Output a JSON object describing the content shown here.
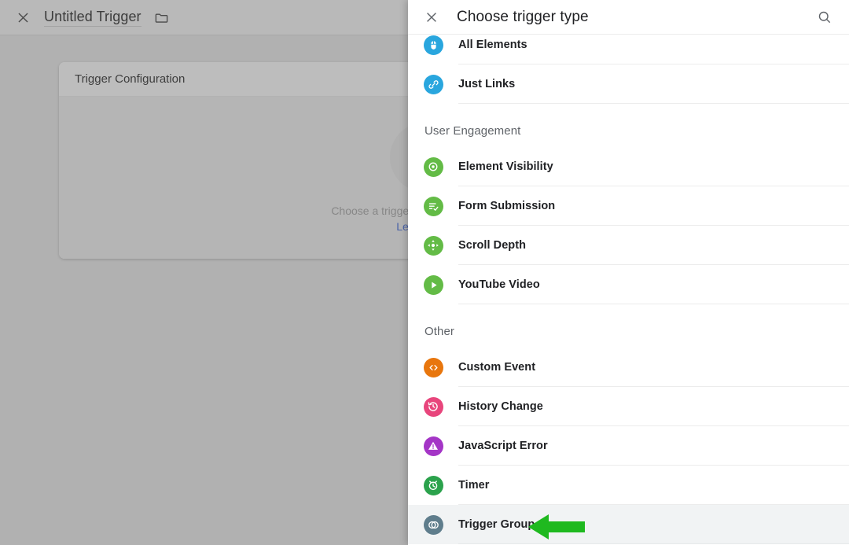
{
  "background": {
    "close_icon": "close-icon",
    "trigger_name": "Untitled Trigger",
    "folder_icon": "folder-icon",
    "card": {
      "title": "Trigger Configuration",
      "placeholder_icon": "trigger-group-icon",
      "hint": "Choose a trigger type to begin setup...",
      "link": "Learn More"
    }
  },
  "panel": {
    "close_icon": "close-icon",
    "title": "Choose trigger type",
    "search_icon": "search-icon",
    "groups": [
      {
        "title": null,
        "items": [
          {
            "label": "All Elements",
            "icon": "mouse-click-icon",
            "color": "#29a6de",
            "highlight": false
          },
          {
            "label": "Just Links",
            "icon": "link-icon",
            "color": "#29a6de",
            "highlight": false
          }
        ]
      },
      {
        "title": "User Engagement",
        "items": [
          {
            "label": "Element Visibility",
            "icon": "eye-icon",
            "color": "#63bb46",
            "highlight": false
          },
          {
            "label": "Form Submission",
            "icon": "form-check-icon",
            "color": "#63bb46",
            "highlight": false
          },
          {
            "label": "Scroll Depth",
            "icon": "scroll-icon",
            "color": "#63bb46",
            "highlight": false
          },
          {
            "label": "YouTube Video",
            "icon": "play-icon",
            "color": "#63bb46",
            "highlight": false
          }
        ]
      },
      {
        "title": "Other",
        "items": [
          {
            "label": "Custom Event",
            "icon": "code-brackets-icon",
            "color": "#e8760d",
            "highlight": false
          },
          {
            "label": "History Change",
            "icon": "history-icon",
            "color": "#e8457c",
            "highlight": false
          },
          {
            "label": "JavaScript Error",
            "icon": "warning-icon",
            "color": "#a435c6",
            "highlight": false
          },
          {
            "label": "Timer",
            "icon": "alarm-icon",
            "color": "#2ba24c",
            "highlight": false
          },
          {
            "label": "Trigger Group",
            "icon": "trigger-group-icon",
            "color": "#5f7d8c",
            "highlight": true
          }
        ]
      }
    ]
  },
  "annotation": {
    "arrow_icon": "left-arrow-annotation",
    "color": "#1fb91f",
    "points_to": "Trigger Group"
  }
}
